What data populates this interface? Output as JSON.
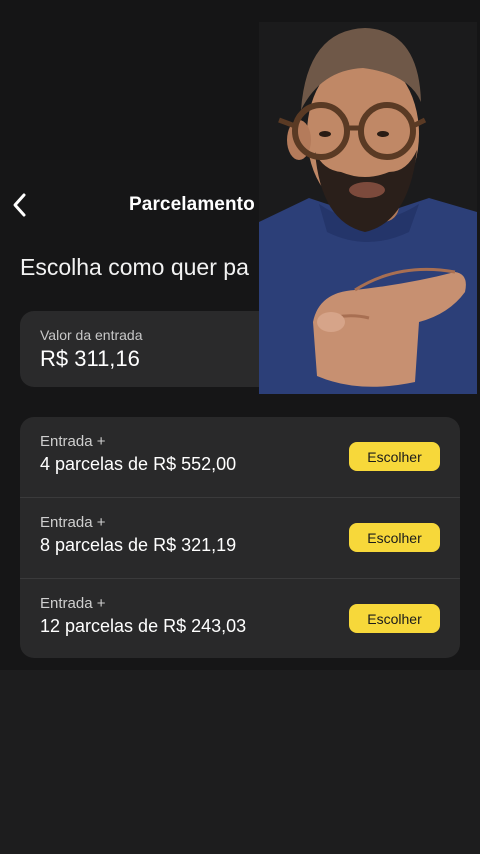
{
  "header": {
    "title": "Parcelamento de fa"
  },
  "subtitle": "Escolha como quer pa",
  "entry": {
    "label": "Valor da entrada",
    "value": "R$ 311,16"
  },
  "options": [
    {
      "prefix": "Entrada +",
      "installments": "4 parcelas de R$ 552,00",
      "button": "Escolher"
    },
    {
      "prefix": "Entrada +",
      "installments": "8 parcelas de R$ 321,19",
      "button": "Escolher"
    },
    {
      "prefix": "Entrada +",
      "installments": "12 parcelas de R$ 243,03",
      "button": "Escolher"
    }
  ],
  "colors": {
    "background": "#161617",
    "card": "#2a2a2b",
    "accent_button": "#f7d83a"
  },
  "icons": {
    "back": "chevron-left-icon"
  }
}
